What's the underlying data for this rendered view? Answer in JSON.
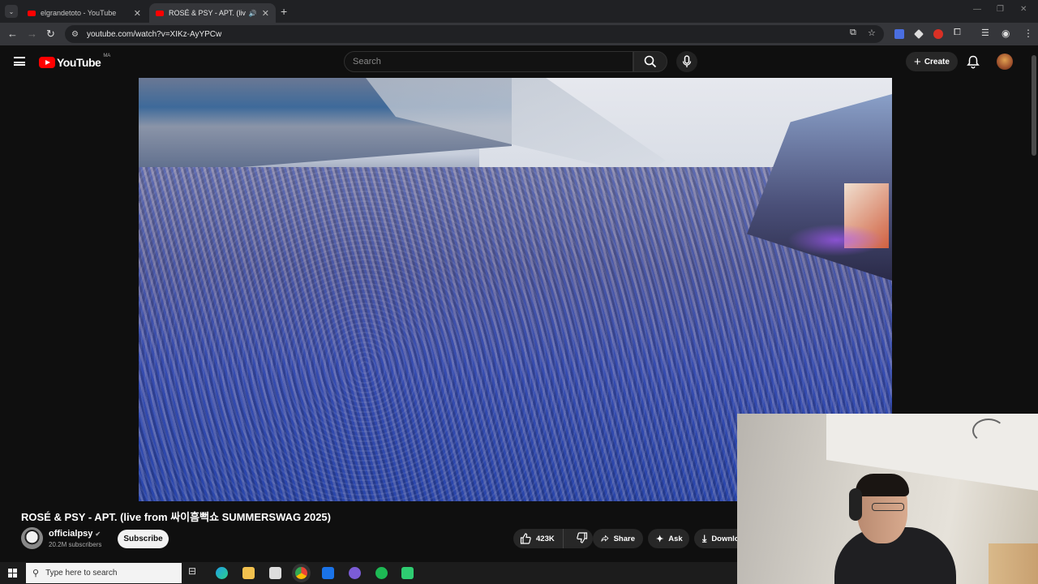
{
  "browser": {
    "tabs": [
      {
        "title": "elgrandetoto - YouTube",
        "active": false
      },
      {
        "title": "ROSÉ & PSY - APT. (live fro",
        "active": true
      }
    ],
    "url": "youtube.com/watch?v=XIKz-AyYPCw"
  },
  "youtube": {
    "logo_text": "YouTube",
    "country_code": "MA",
    "search_placeholder": "Search",
    "create_label": "Create"
  },
  "video": {
    "title": "ROSÉ & PSY - APT. (live from 싸이흠뻑쇼 SUMMERSWAG 2025)",
    "channel_name": "officialpsy",
    "subscribers": "20.2M subscribers",
    "subscribe_label": "Subscribe",
    "likes": "423K",
    "share_label": "Share",
    "ask_label": "Ask",
    "download_label": "Download"
  },
  "taskbar": {
    "search_placeholder": "Type here to search"
  },
  "colors": {
    "youtube_red": "#ff0000",
    "background": "#0f0f0f",
    "chrome_tabbar": "#202124",
    "chrome_toolbar": "#35363a"
  }
}
